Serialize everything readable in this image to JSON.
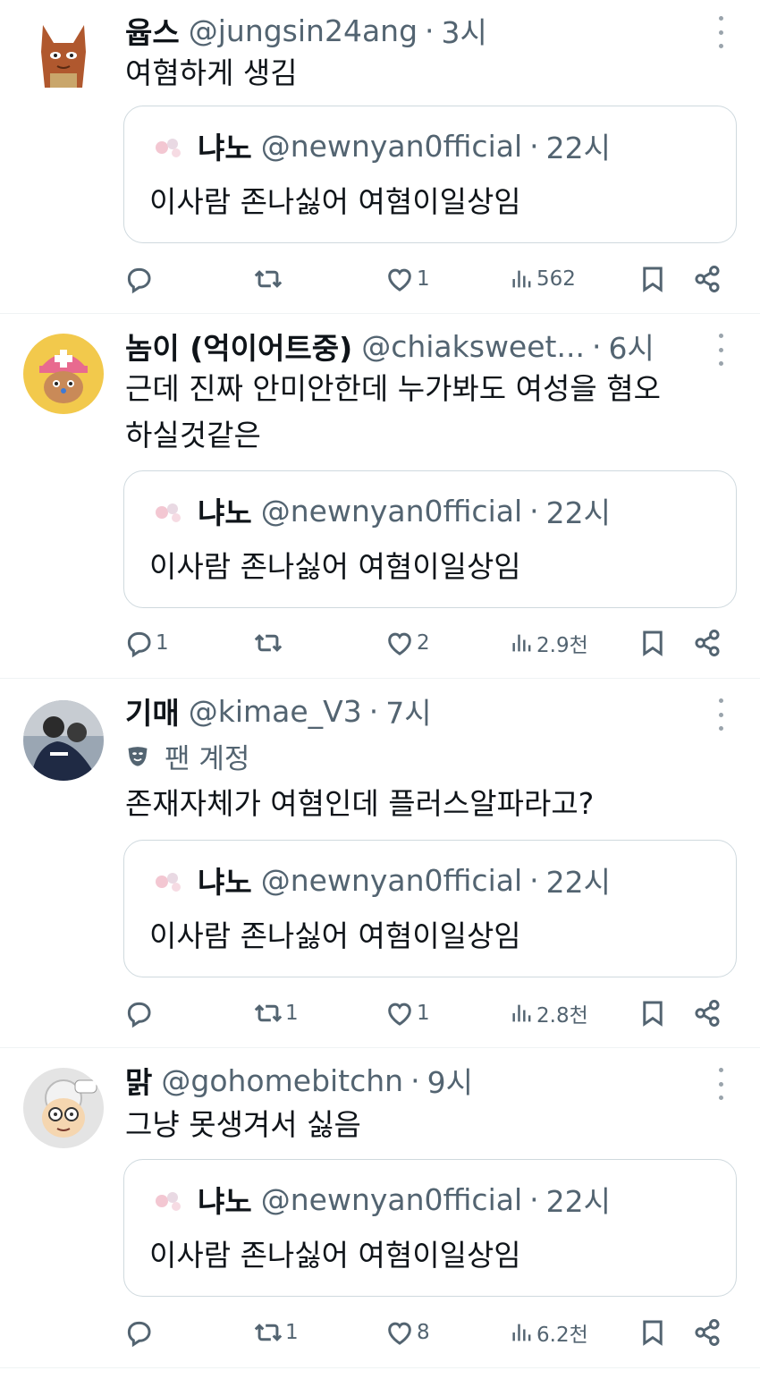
{
  "tweets": [
    {
      "name": "윱스",
      "handle": "@jungsin24ang",
      "sep": "·",
      "time": "3시",
      "text": "여혐하게 생김",
      "avatar": "brown-fox-avatar",
      "quote": {
        "name": "냐노",
        "handle": "@newnyan0fficial",
        "sep": "·",
        "time": "22시",
        "text": "이사람 존나싫어 여혐이일상임"
      },
      "replies": "",
      "retweets": "",
      "likes": "1",
      "views": "562"
    },
    {
      "name": "놈이 (억이어트중)",
      "handle": "@chiaksweet...",
      "sep": "·",
      "time": "6시",
      "text": "근데 진짜 안미안한데 누가봐도 여성을 혐오하실것같은",
      "avatar": "chopper-avatar",
      "quote": {
        "name": "냐노",
        "handle": "@newnyan0fficial",
        "sep": "·",
        "time": "22시",
        "text": "이사람 존나싫어 여혐이일상임"
      },
      "replies": "1",
      "retweets": "",
      "likes": "2",
      "views": "2.9천"
    },
    {
      "name": "기매",
      "handle": "@kimae_V3",
      "sep": "·",
      "time": "7시",
      "badge": "팬 계정",
      "text": "존재자체가 여혐인데 플러스알파라고?",
      "avatar": "athletes-photo-avatar",
      "quote": {
        "name": "냐노",
        "handle": "@newnyan0fficial",
        "sep": "·",
        "time": "22시",
        "text": "이사람 존나싫어 여혐이일상임"
      },
      "replies": "",
      "retweets": "1",
      "likes": "1",
      "views": "2.8천"
    },
    {
      "name": "맑",
      "handle": "@gohomebitchn",
      "sep": "·",
      "time": "9시",
      "text": "그냥 못생겨서 싫음",
      "avatar": "grandma-cartoon-avatar",
      "quote": {
        "name": "냐노",
        "handle": "@newnyan0fficial",
        "sep": "·",
        "time": "22시",
        "text": "이사람 존나싫어 여혐이일상임"
      },
      "replies": "",
      "retweets": "1",
      "likes": "8",
      "views": "6.2천"
    }
  ],
  "icons": {
    "reply": "reply-icon",
    "retweet": "retweet-icon",
    "like": "heart-icon",
    "views": "views-icon",
    "bookmark": "bookmark-icon",
    "share": "share-icon",
    "more": "more-icon",
    "fan_badge": "theater-mask-icon"
  },
  "colors": {
    "text": "#0f1419",
    "muted": "#536471",
    "border": "#cfd9de",
    "divider": "#eff3f4"
  }
}
